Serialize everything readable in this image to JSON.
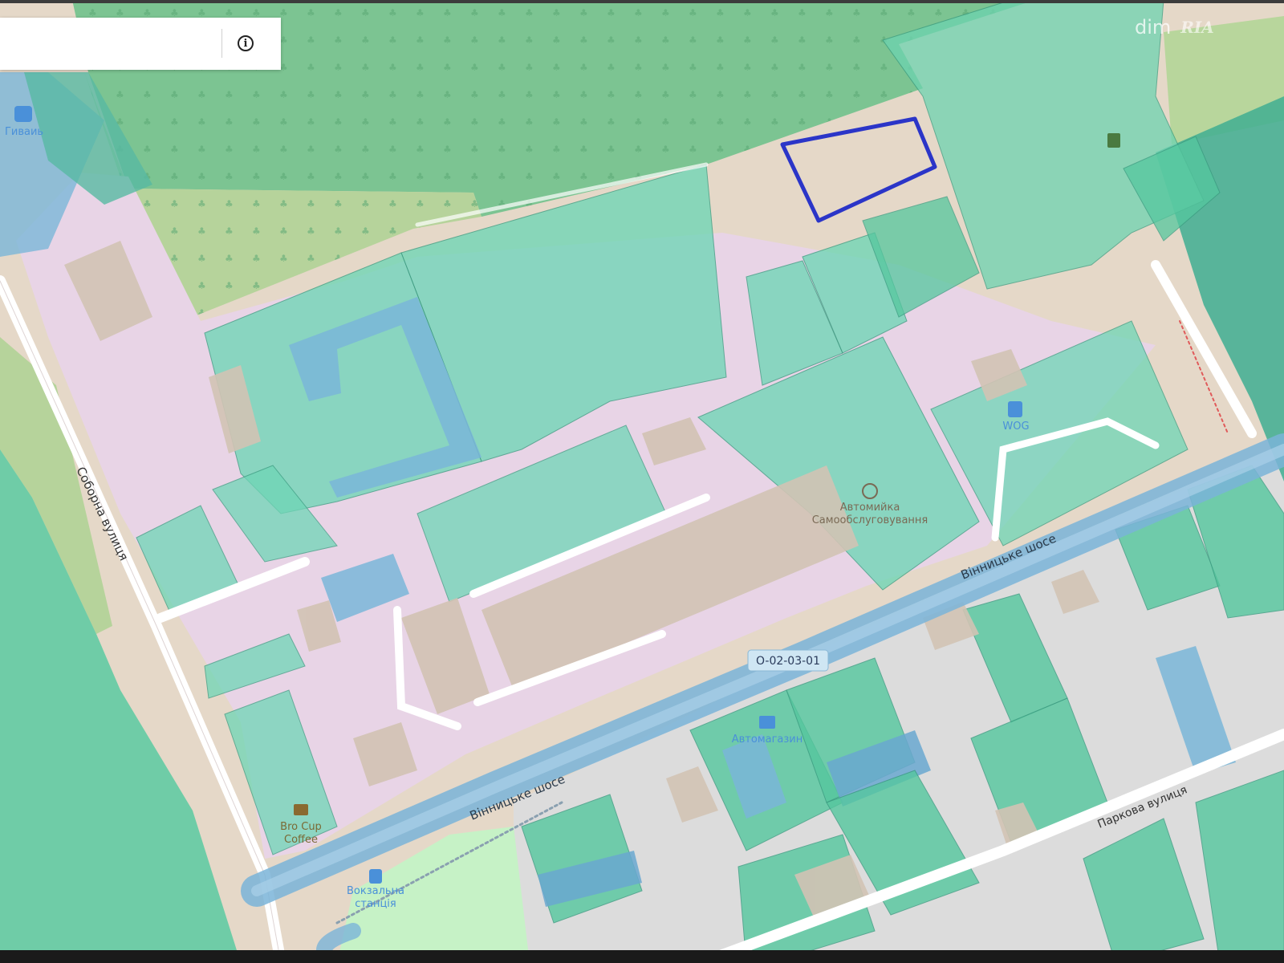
{
  "search": {
    "value": "",
    "placeholder": ""
  },
  "info_button": {
    "glyph": "i"
  },
  "watermark": {
    "dim": "dim",
    "ria": "RIA"
  },
  "map": {
    "streets": {
      "soborna": "Соборна вулиця",
      "vinnytske_upper": "Вінницьке шосе",
      "vinnytske_lower": "Вінницьке шосе",
      "parkova": "Паркова вулиця"
    },
    "road_badge": "O-02-03-01",
    "pois": {
      "bus_stop": {
        "icon": "bus-stop-icon",
        "label": "Гиваиь"
      },
      "fuel": {
        "icon": "fuel-station-icon",
        "label": "WOG"
      },
      "car_wash": {
        "icon": "car-wash-icon",
        "label_line1": "Автомийка",
        "label_line2": "Самообслуговування"
      },
      "shop": {
        "icon": "shop-icon",
        "label": "Автомагазин"
      },
      "coffee": {
        "icon": "coffee-icon",
        "label_line1": "Bro Cup",
        "label_line2": "Coffee"
      },
      "railway": {
        "icon": "train-icon",
        "label_line1": "Вокзальна",
        "label_line2": "станція"
      }
    },
    "colors": {
      "parcel": "#5fd0a0",
      "parcel_edge": "#3a9c80",
      "highlight": "#2b35c8",
      "forest": "#79c28e",
      "meadow": "#b5d29a",
      "industrial": "#e8d4e6",
      "residential": "#dcdcdc",
      "road": "#ffffff",
      "road_blue": "#7ab4d8",
      "building": "#d2c3b4"
    }
  }
}
